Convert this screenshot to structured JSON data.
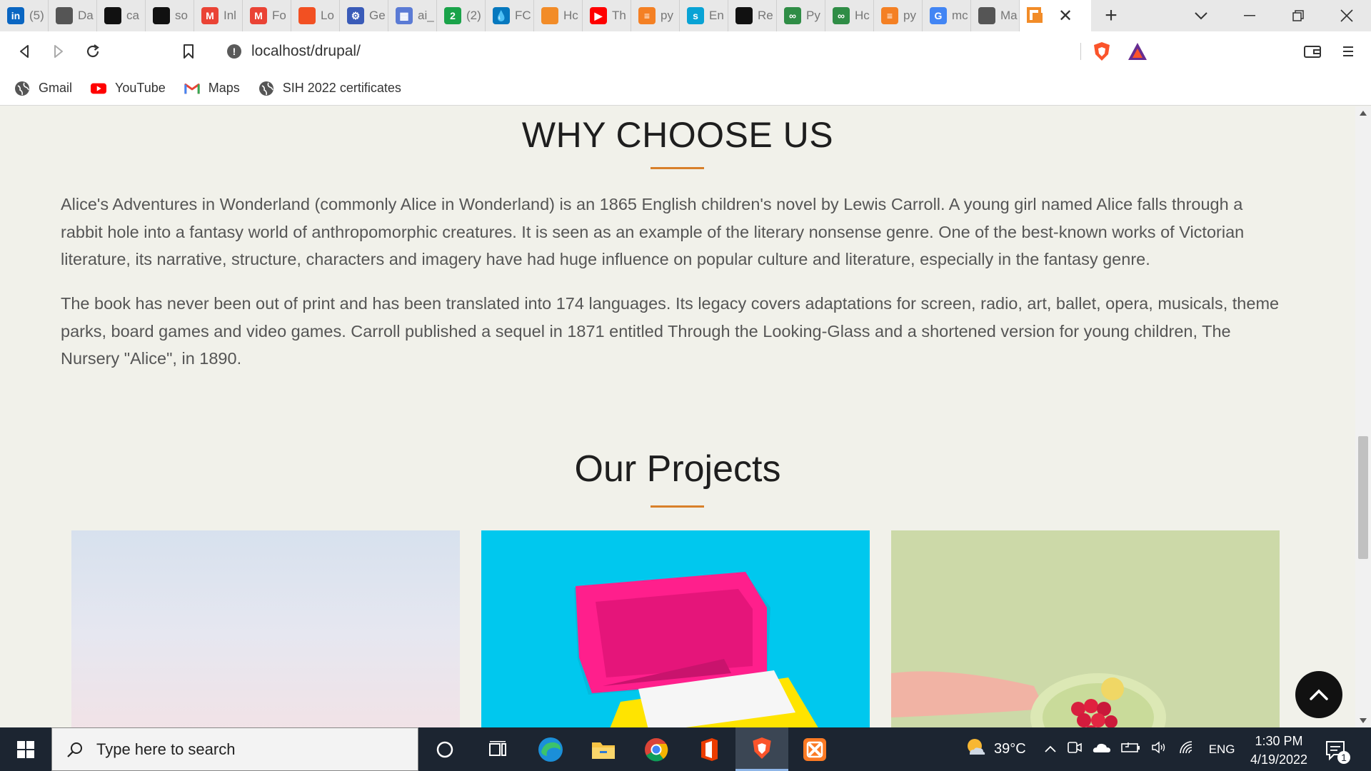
{
  "browser": {
    "tabs": [
      {
        "icon": "linkedin-icon",
        "label": "(5)",
        "color": "#0a66c2",
        "glyph": "in"
      },
      {
        "icon": "globe-icon",
        "label": "Da",
        "color": "#555555",
        "glyph": ""
      },
      {
        "icon": "github-icon",
        "label": "ca",
        "color": "#111111",
        "glyph": ""
      },
      {
        "icon": "github-icon",
        "label": "so",
        "color": "#111111",
        "glyph": ""
      },
      {
        "icon": "gmail-icon",
        "label": "Inl",
        "color": "#ea4335",
        "glyph": "M"
      },
      {
        "icon": "gmail-icon",
        "label": "Fo",
        "color": "#ea4335",
        "glyph": "M"
      },
      {
        "icon": "microsoft-icon",
        "label": "Lo",
        "color": "#f25022",
        "glyph": ""
      },
      {
        "icon": "gear-icon",
        "label": "Ge",
        "color": "#3a5bb8",
        "glyph": "⚙"
      },
      {
        "icon": "grid-icon",
        "label": "ai_",
        "color": "#5b7bd5",
        "glyph": "▦"
      },
      {
        "icon": "number-two-icon",
        "label": "(2)",
        "color": "#1aa34a",
        "glyph": "2"
      },
      {
        "icon": "drupal-icon",
        "label": "FC",
        "color": "#0678be",
        "glyph": "💧"
      },
      {
        "icon": "orange-square-icon",
        "label": "Hc",
        "color": "#f28c28",
        "glyph": ""
      },
      {
        "icon": "youtube-icon",
        "label": "Th",
        "color": "#ff0000",
        "glyph": "▶"
      },
      {
        "icon": "stackoverflow-icon",
        "label": "py",
        "color": "#f48024",
        "glyph": "≡"
      },
      {
        "icon": "spacy-icon",
        "label": "En",
        "color": "#09a3d5",
        "glyph": "s"
      },
      {
        "icon": "github-icon",
        "label": "Re",
        "color": "#111111",
        "glyph": ""
      },
      {
        "icon": "geeksforgeeks-icon",
        "label": "Py",
        "color": "#2f8d46",
        "glyph": "∞"
      },
      {
        "icon": "geeksforgeeks-icon",
        "label": "Hc",
        "color": "#2f8d46",
        "glyph": "∞"
      },
      {
        "icon": "stackoverflow-icon",
        "label": "py",
        "color": "#f48024",
        "glyph": "≡"
      },
      {
        "icon": "google-icon",
        "label": "mc",
        "color": "#4285f4",
        "glyph": "G"
      },
      {
        "icon": "globe-icon",
        "label": "Ma",
        "color": "#555555",
        "glyph": ""
      }
    ],
    "active_tab": {
      "icon": "orange-square-icon",
      "color": "#f28c28",
      "close": "✕"
    },
    "new_tab": "+",
    "url": "localhost/drupal/",
    "bookmarks": [
      {
        "label": "Gmail",
        "icon": "globe-icon"
      },
      {
        "label": "YouTube",
        "icon": "youtube-icon"
      },
      {
        "label": "Maps",
        "icon": "gmail-icon"
      },
      {
        "label": "SIH 2022 certificates",
        "icon": "globe-icon"
      }
    ]
  },
  "page": {
    "why_title": "WHY CHOOSE US",
    "paragraph_1": "Alice's Adventures in Wonderland (commonly Alice in Wonderland) is an 1865 English children's novel by Lewis Carroll. A young girl named Alice falls through a rabbit hole into a fantasy world of anthropomorphic creatures. It is seen as an example of the literary nonsense genre. One of the best-known works of Victorian literature, its narrative, structure, characters and imagery have had huge influence on popular culture and literature, especially in the fantasy genre.",
    "paragraph_2": "The book has never been out of print and has been translated into 174 languages. Its legacy covers adaptations for screen, radio, art, ballet, opera, musicals, theme parks, board games and video games. Carroll published a sequel in 1871 entitled Through the Looking-Glass and a shortened version for young children, The Nursery \"Alice\", in 1890.",
    "projects_title": "Our Projects",
    "accent_color": "#d8802a",
    "projects": [
      {
        "image": "pastel-sky-image"
      },
      {
        "image": "pink-box-image"
      },
      {
        "image": "raspberry-bowl-image"
      }
    ]
  },
  "taskbar": {
    "search_placeholder": "Type here to search",
    "temperature": "39°C",
    "language": "ENG",
    "time": "1:30 PM",
    "date": "4/19/2022",
    "notifications": "1"
  }
}
